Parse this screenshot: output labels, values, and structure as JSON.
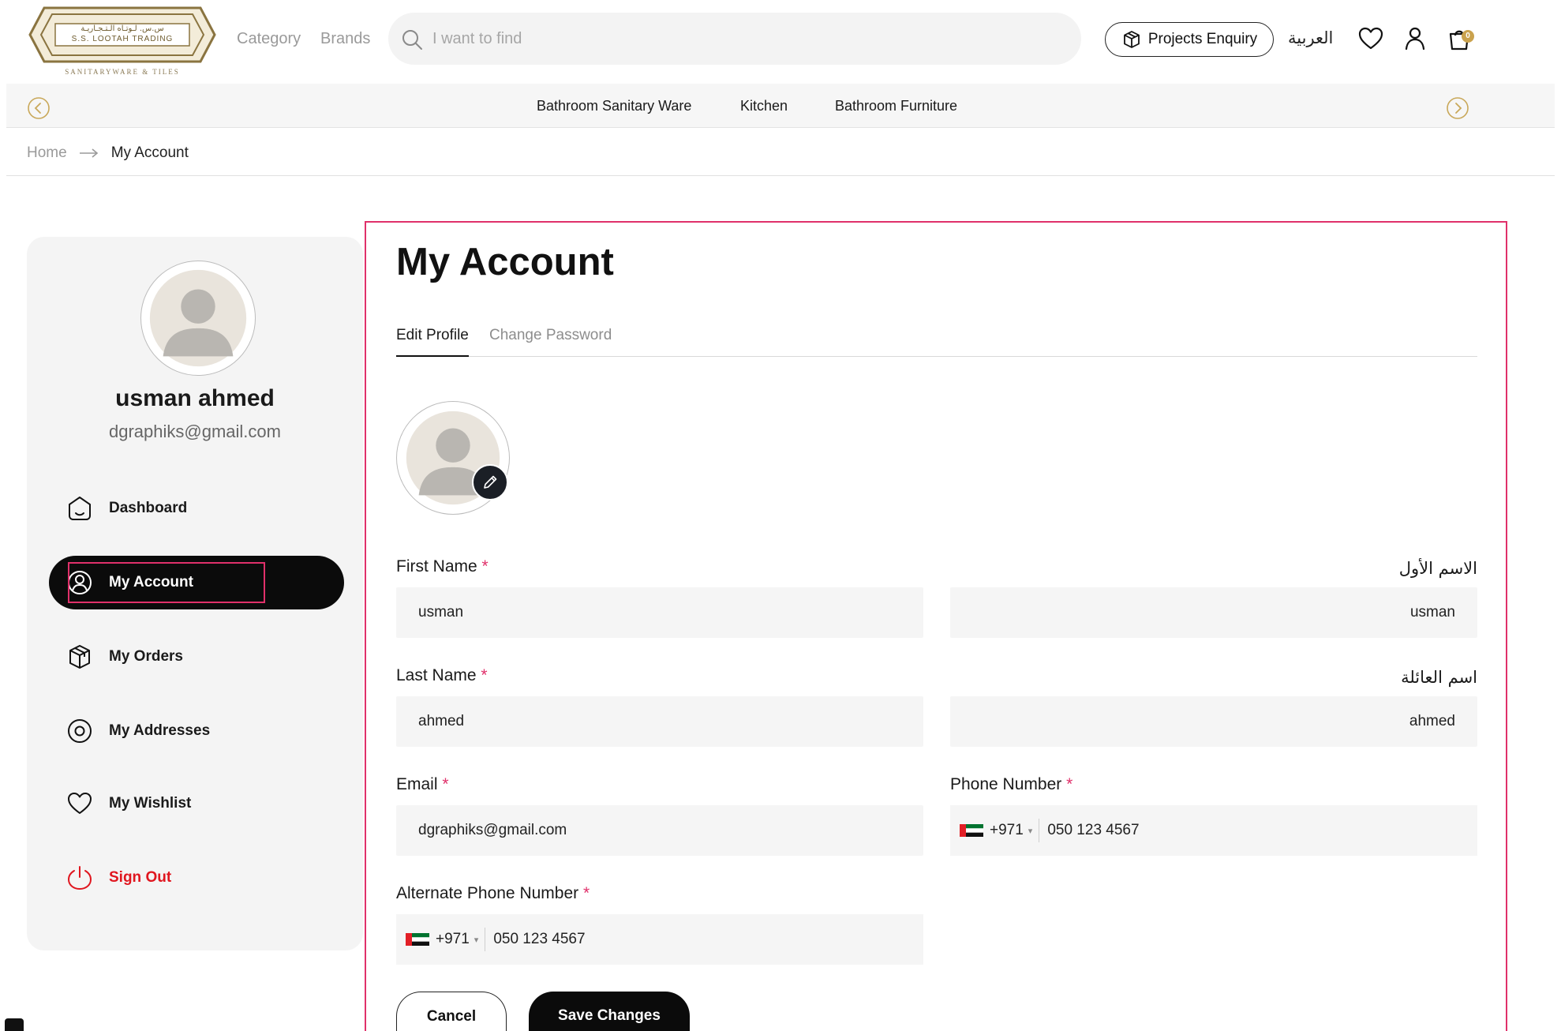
{
  "header": {
    "logo_text_ar": "س.س. لـوتـاه الـتـجـاريـة",
    "logo_text_en": "S.S. LOOTAH TRADING",
    "logo_tagline": "SANITARYWARE & TILES",
    "nav": {
      "category": "Category",
      "brands": "Brands"
    },
    "search": {
      "placeholder": "I want to find",
      "value": ""
    },
    "projects_enquiry": "Projects Enquiry",
    "language": "العربية",
    "cart_count": "0",
    "brand_color": "#caa24d"
  },
  "category_bar": {
    "items": [
      "Bathroom Sanitary Ware",
      "Kitchen",
      "Bathroom Furniture"
    ]
  },
  "breadcrumb": {
    "home": "Home",
    "current": "My Account"
  },
  "sidebar": {
    "user_name": "usman ahmed",
    "user_email": "dgraphiks@gmail.com",
    "menu": [
      {
        "label": "Dashboard",
        "icon": "home-icon"
      },
      {
        "label": "My Account",
        "icon": "user-circle-icon"
      },
      {
        "label": "My Orders",
        "icon": "box-icon"
      },
      {
        "label": "My Addresses",
        "icon": "location-icon"
      },
      {
        "label": "My Wishlist",
        "icon": "heart-icon"
      },
      {
        "label": "Sign Out",
        "icon": "power-icon"
      }
    ],
    "active_item": "My Account"
  },
  "main": {
    "title": "My Account",
    "tabs": [
      "Edit Profile",
      "Change Password"
    ],
    "active_tab": "Edit Profile",
    "form": {
      "first_name": {
        "label": "First Name",
        "value": "usman"
      },
      "first_name_ar": {
        "label": "الاسم الأول",
        "value": "usman"
      },
      "last_name": {
        "label": "Last Name",
        "value": "ahmed"
      },
      "last_name_ar": {
        "label": "اسم العائلة",
        "value": "ahmed"
      },
      "email": {
        "label": "Email",
        "value": "dgraphiks@gmail.com"
      },
      "phone": {
        "label": "Phone Number",
        "country_code": "+971",
        "value": "050 123 4567"
      },
      "alt_phone": {
        "label": "Alternate Phone Number",
        "country_code": "+971",
        "value": "050 123 4567"
      },
      "required_mark": "*"
    },
    "buttons": {
      "cancel": "Cancel",
      "save": "Save Changes"
    },
    "highlight_color": "#e0306a"
  }
}
